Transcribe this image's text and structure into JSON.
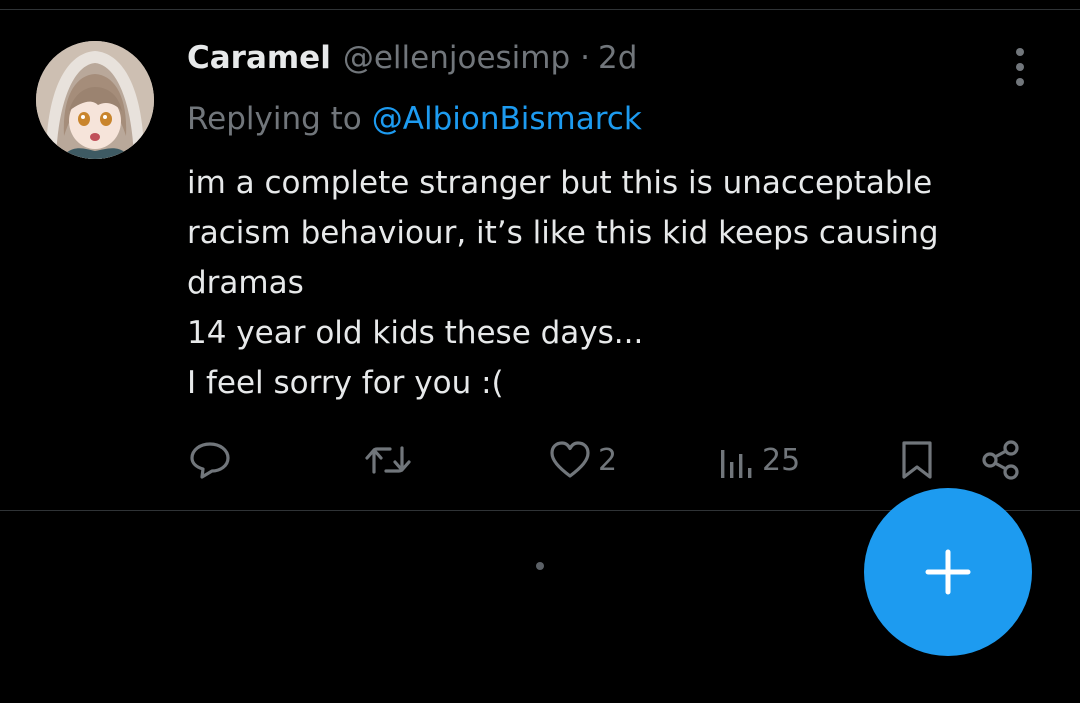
{
  "tweet": {
    "author": {
      "display_name": "Caramel",
      "handle": "@ellenjoesimp",
      "separator": "·",
      "time": "2d"
    },
    "reply": {
      "prefix": "Replying to",
      "mention": "@AlbionBismarck"
    },
    "text_lines": [
      "im a complete stranger but this is unacceptable",
      "racism behaviour, it’s like this kid keeps causing",
      "dramas",
      "14 year old kids these days...",
      "I feel sorry for you :("
    ],
    "actions": {
      "likes": "2",
      "views": "25"
    }
  },
  "colors": {
    "background": "#000000",
    "text": "#e7e9ea",
    "muted": "#71767b",
    "accent": "#1d9bf0",
    "divider": "#2f3336"
  },
  "icons": {
    "reply": "reply-icon",
    "retweet": "retweet-icon",
    "like": "heart-icon",
    "views": "views-icon",
    "bookmark": "bookmark-icon",
    "share": "share-icon",
    "more": "more-vertical-icon",
    "compose": "plus-icon"
  }
}
